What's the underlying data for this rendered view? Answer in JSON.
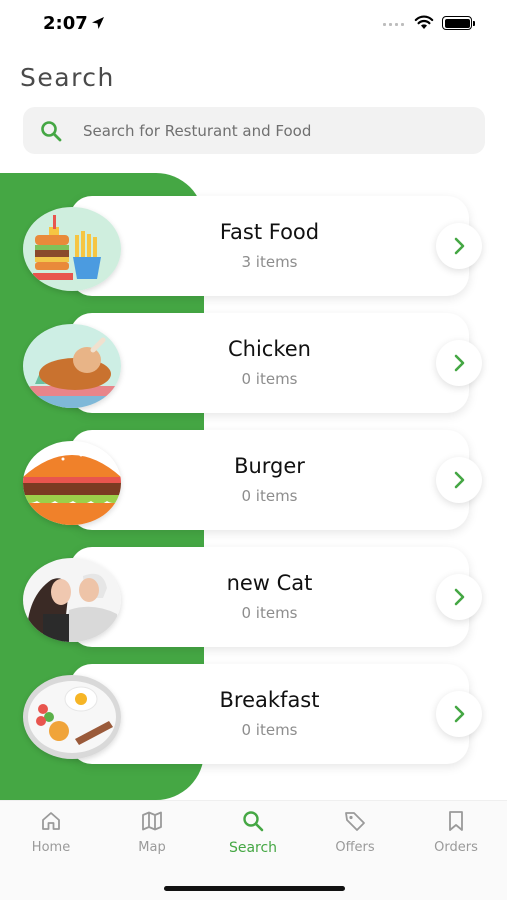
{
  "status_bar": {
    "time": "2:07"
  },
  "page": {
    "title": "Search"
  },
  "search": {
    "placeholder": "Search for Resturant and Food",
    "value": ""
  },
  "categories": [
    {
      "name": "Fast Food",
      "count": "3 items",
      "image_icon": "fast-food-image"
    },
    {
      "name": "Chicken",
      "count": "0 items",
      "image_icon": "chicken-image"
    },
    {
      "name": "Burger",
      "count": "0 items",
      "image_icon": "burger-image"
    },
    {
      "name": "new Cat",
      "count": "0 items",
      "image_icon": "couple-photo-image"
    },
    {
      "name": "Breakfast",
      "count": "0 items",
      "image_icon": "breakfast-image"
    }
  ],
  "tabs": [
    {
      "label": "Home",
      "icon": "home-icon",
      "active": false
    },
    {
      "label": "Map",
      "icon": "map-icon",
      "active": false
    },
    {
      "label": "Search",
      "icon": "search-icon",
      "active": true
    },
    {
      "label": "Offers",
      "icon": "tag-icon",
      "active": false
    },
    {
      "label": "Orders",
      "icon": "bookmark-icon",
      "active": false
    }
  ],
  "colors": {
    "accent": "#45a744",
    "muted": "#9a9a9a",
    "card_bg": "#ffffff",
    "search_bg": "#f2f2f2"
  }
}
